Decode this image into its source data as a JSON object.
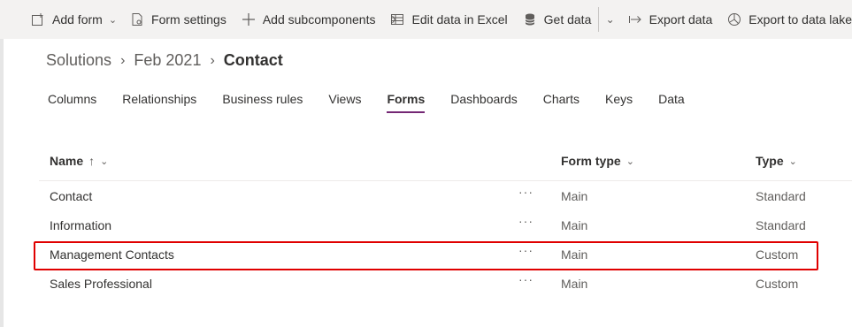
{
  "toolbar": {
    "add_form": "Add form",
    "form_settings": "Form settings",
    "add_subcomponents": "Add subcomponents",
    "edit_excel": "Edit data in Excel",
    "get_data": "Get data",
    "export_data": "Export data",
    "export_lake": "Export to data lake"
  },
  "breadcrumb": {
    "root": "Solutions",
    "solution": "Feb 2021",
    "current": "Contact"
  },
  "tabs": [
    "Columns",
    "Relationships",
    "Business rules",
    "Views",
    "Forms",
    "Dashboards",
    "Charts",
    "Keys",
    "Data"
  ],
  "active_tab": "Forms",
  "table": {
    "headers": {
      "name": "Name",
      "name_sort": "↑",
      "form_type": "Form type",
      "type": "Type"
    },
    "rows": [
      {
        "name": "Contact",
        "more": "···",
        "form_type": "Main",
        "type": "Standard"
      },
      {
        "name": "Information",
        "more": "···",
        "form_type": "Main",
        "type": "Standard"
      },
      {
        "name": "Management Contacts",
        "more": "···",
        "form_type": "Main",
        "type": "Custom"
      },
      {
        "name": "Sales Professional",
        "more": "···",
        "form_type": "Main",
        "type": "Custom"
      }
    ]
  },
  "colors": {
    "accent": "#742774",
    "highlight": "#e00000",
    "toolbar_bg": "#f3f2f1"
  },
  "icons": {
    "add_form": "form-add-icon",
    "form_settings": "form-settings-icon",
    "add_subcomponents": "plus-icon",
    "edit_excel": "excel-icon",
    "get_data": "database-icon",
    "export_data": "export-arrow-icon",
    "export_lake": "data-lake-icon"
  }
}
